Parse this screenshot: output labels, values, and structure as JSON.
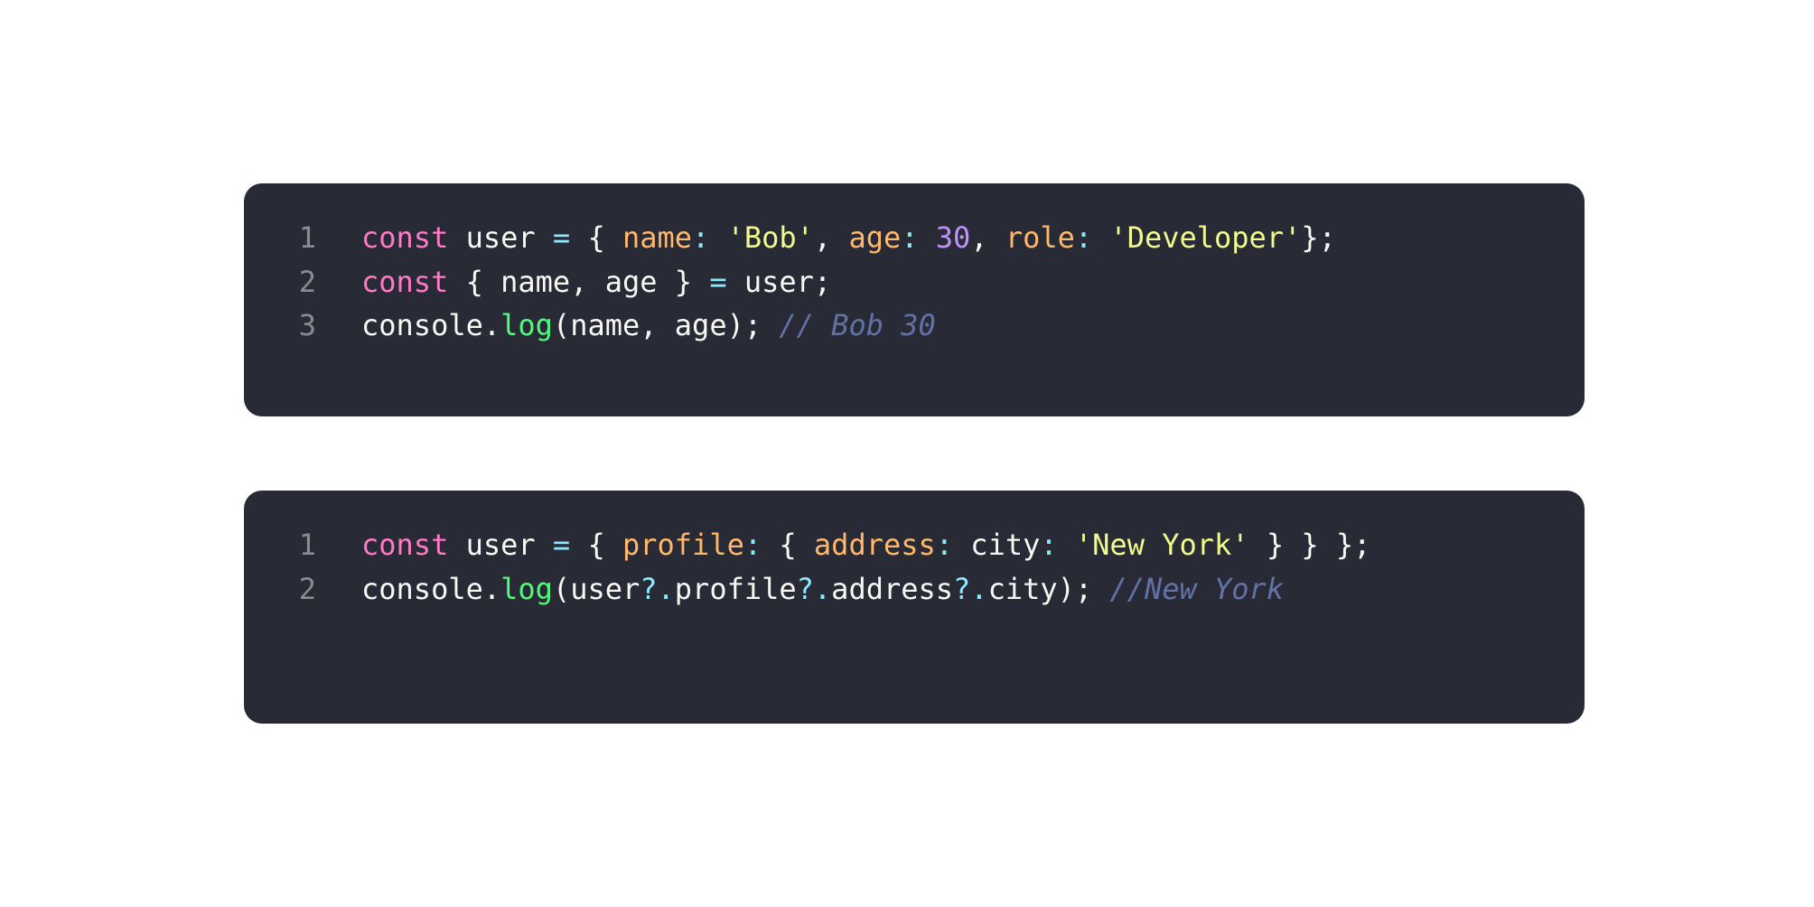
{
  "colors": {
    "keyword": "#ff79c6",
    "plain": "#f8f8f2",
    "operator": "#8be9fd",
    "property": "#ffb86c",
    "string": "#f1fa8c",
    "number": "#bd93f9",
    "function": "#50fa7b",
    "comment": "#6272a4",
    "line_number": "#8a8c94",
    "background": "#282a36"
  },
  "blocks": [
    {
      "lines": [
        {
          "number": "1",
          "tokens": [
            {
              "t": "const",
              "c": "keyword"
            },
            {
              "t": " user ",
              "c": "plain"
            },
            {
              "t": "=",
              "c": "operator"
            },
            {
              "t": " { ",
              "c": "plain"
            },
            {
              "t": "name",
              "c": "property"
            },
            {
              "t": ":",
              "c": "operator"
            },
            {
              "t": " ",
              "c": "plain"
            },
            {
              "t": "'Bob'",
              "c": "string"
            },
            {
              "t": ", ",
              "c": "plain"
            },
            {
              "t": "age",
              "c": "property"
            },
            {
              "t": ":",
              "c": "operator"
            },
            {
              "t": " ",
              "c": "plain"
            },
            {
              "t": "30",
              "c": "number"
            },
            {
              "t": ", ",
              "c": "plain"
            },
            {
              "t": "role",
              "c": "property"
            },
            {
              "t": ":",
              "c": "operator"
            },
            {
              "t": " ",
              "c": "plain"
            },
            {
              "t": "'Developer'",
              "c": "string"
            },
            {
              "t": "};",
              "c": "plain"
            }
          ]
        },
        {
          "number": "2",
          "tokens": [
            {
              "t": "const",
              "c": "keyword"
            },
            {
              "t": " { name, age } ",
              "c": "plain"
            },
            {
              "t": "=",
              "c": "operator"
            },
            {
              "t": " user;",
              "c": "plain"
            }
          ]
        },
        {
          "number": "3",
          "tokens": [
            {
              "t": "console.",
              "c": "plain"
            },
            {
              "t": "log",
              "c": "function"
            },
            {
              "t": "(name, age); ",
              "c": "plain"
            },
            {
              "t": "// Bob 30",
              "c": "comment"
            }
          ]
        }
      ]
    },
    {
      "lines": [
        {
          "number": "1",
          "tokens": [
            {
              "t": "const",
              "c": "keyword"
            },
            {
              "t": " user ",
              "c": "plain"
            },
            {
              "t": "=",
              "c": "operator"
            },
            {
              "t": " { ",
              "c": "plain"
            },
            {
              "t": "profile",
              "c": "property"
            },
            {
              "t": ":",
              "c": "operator"
            },
            {
              "t": " { ",
              "c": "plain"
            },
            {
              "t": "address",
              "c": "property"
            },
            {
              "t": ":",
              "c": "operator"
            },
            {
              "t": " city",
              "c": "plain"
            },
            {
              "t": ":",
              "c": "operator"
            },
            {
              "t": " ",
              "c": "plain"
            },
            {
              "t": "'New York'",
              "c": "string"
            },
            {
              "t": " } } };",
              "c": "plain"
            }
          ]
        },
        {
          "number": "2",
          "tokens": [
            {
              "t": "console.",
              "c": "plain"
            },
            {
              "t": "log",
              "c": "function"
            },
            {
              "t": "(user",
              "c": "plain"
            },
            {
              "t": "?.",
              "c": "operator"
            },
            {
              "t": "profile",
              "c": "plain"
            },
            {
              "t": "?.",
              "c": "operator"
            },
            {
              "t": "address",
              "c": "plain"
            },
            {
              "t": "?.",
              "c": "operator"
            },
            {
              "t": "city); ",
              "c": "plain"
            },
            {
              "t": "//New York",
              "c": "comment"
            }
          ]
        }
      ]
    }
  ]
}
